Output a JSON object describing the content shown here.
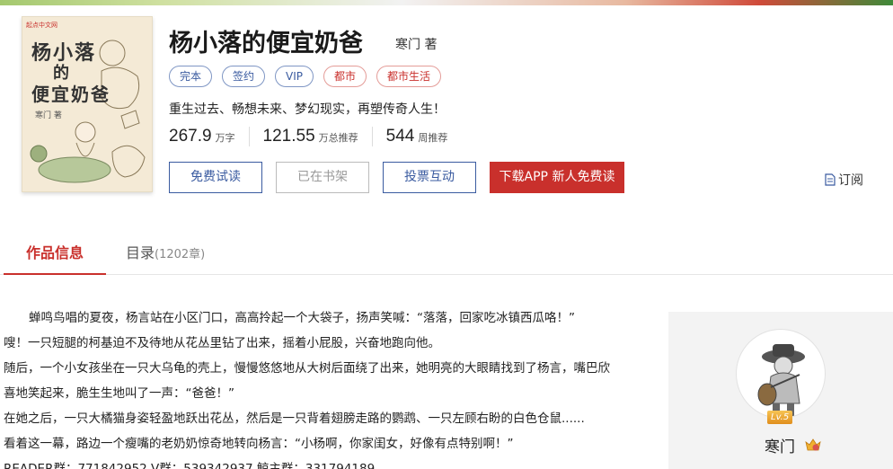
{
  "book": {
    "cover": {
      "badge": "起点中文网",
      "title_line1": "杨小落",
      "title_line2": "的",
      "title_line3": "便宜奶爸",
      "author_line": "寒门 著"
    },
    "title": "杨小落的便宜奶爸",
    "author": "寒门 著",
    "tags": [
      "完本",
      "签约",
      "VIP",
      "都市",
      "都市生活"
    ],
    "intro": "重生过去、畅想未来、梦幻现实，再塑传奇人生！",
    "stats": [
      {
        "value": "267.9",
        "unit": "万字"
      },
      {
        "value": "121.55",
        "unit": "万总推荐"
      },
      {
        "value": "544",
        "unit": "周推荐"
      }
    ]
  },
  "actions": {
    "free_read": "免费试读",
    "in_shelf": "已在书架",
    "vote": "投票互动",
    "download": "下载APP 新人免费读",
    "subscribe": "订阅"
  },
  "tabs": {
    "info": "作品信息",
    "catalog": "目录",
    "catalog_count": "(1202章)"
  },
  "content": {
    "paragraphs": [
      "蝉鸣鸟唱的夏夜，杨言站在小区门口，高高拎起一个大袋子，扬声笑喊：“落落，回家吃冰镇西瓜咯！”",
      "嗖！一只短腿的柯基迫不及待地从花丛里钻了出来，摇着小屁股，兴奋地跑向他。",
      "随后，一个小女孩坐在一只大乌龟的壳上，慢慢悠悠地从大树后面绕了出来，她明亮的大眼睛找到了杨言，嘴巴欣",
      "喜地笑起来，脆生生地叫了一声：“爸爸！”",
      "在她之后，一只大橘猫身姿轻盈地跃出花丛，然后是一只背着翅膀走路的鹦鹉、一只左顾右盼的白色仓鼠......",
      "看着这一幕，路边一个瘦嘴的老奶奶惊奇地转向杨言：“小杨啊，你家闺女，好像有点特别啊！”",
      "READER群：771842952  V群：539342937  鲸主群：331794189"
    ]
  },
  "author_card": {
    "level": "Lv.5",
    "name": "寒门"
  },
  "colors": {
    "accent_red": "#c9302c",
    "accent_blue": "#3a5ba0"
  }
}
